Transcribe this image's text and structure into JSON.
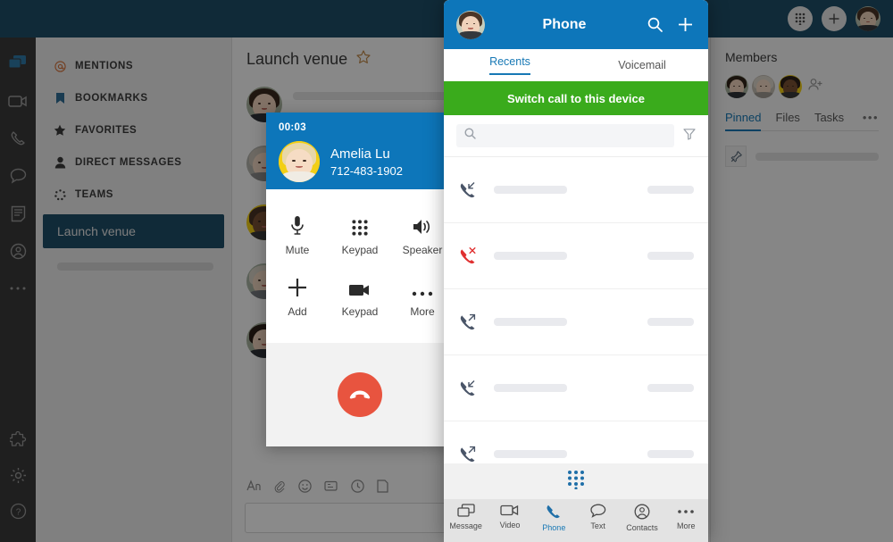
{
  "topbar": {
    "dialpad_icon": "dialpad-icon",
    "add_icon": "plus-icon",
    "avatar_icon": "user-avatar"
  },
  "rail": {
    "items": [
      {
        "icon": "message-icon",
        "name": "rail-message",
        "active": true
      },
      {
        "icon": "video-icon",
        "name": "rail-video",
        "active": false
      },
      {
        "icon": "phone-icon",
        "name": "rail-phone",
        "active": false
      },
      {
        "icon": "text-bubble-icon",
        "name": "rail-text",
        "active": false
      },
      {
        "icon": "tasks-icon",
        "name": "rail-tasks",
        "active": false
      },
      {
        "icon": "contacts-icon",
        "name": "rail-contacts",
        "active": false
      },
      {
        "icon": "more-icon",
        "name": "rail-more",
        "active": false
      }
    ],
    "bottom": [
      {
        "icon": "apps-puzzle-icon",
        "name": "rail-apps"
      },
      {
        "icon": "gear-icon",
        "name": "rail-settings"
      },
      {
        "icon": "help-icon",
        "name": "rail-help"
      }
    ]
  },
  "sidebar": {
    "items": [
      {
        "label": "MENTIONS",
        "icon": "at-icon"
      },
      {
        "label": "BOOKMARKS",
        "icon": "bookmark-icon"
      },
      {
        "label": "FAVORITES",
        "icon": "star-icon"
      },
      {
        "label": "DIRECT MESSAGES",
        "icon": "person-icon"
      },
      {
        "label": "TEAMS",
        "icon": "teams-icon"
      }
    ],
    "selected_team": "Launch venue"
  },
  "main": {
    "title": "Launch venue",
    "favorite_icon": "star-outline-icon",
    "message_count": 5,
    "compose_tools": [
      {
        "name": "format-text-icon"
      },
      {
        "name": "attach-icon"
      },
      {
        "name": "emoji-icon"
      },
      {
        "name": "gif-icon"
      },
      {
        "name": "schedule-icon"
      },
      {
        "name": "file-icon"
      }
    ]
  },
  "right_panel": {
    "title": "Members",
    "member_count": 3,
    "add_member_icon": "add-person-icon",
    "tabs": [
      {
        "label": "Pinned",
        "active": true
      },
      {
        "label": "Files",
        "active": false
      },
      {
        "label": "Tasks",
        "active": false
      }
    ],
    "overflow_label": "•••",
    "pin_icon": "pin-icon"
  },
  "call_dialog": {
    "timer": "00:03",
    "caller_name": "Amelia Lu",
    "caller_number": "712-483-1902",
    "buttons": [
      {
        "label": "Mute",
        "icon": "microphone-icon"
      },
      {
        "label": "Keypad",
        "icon": "dialpad-icon"
      },
      {
        "label": "Speaker",
        "icon": "speaker-icon"
      },
      {
        "label": "Add",
        "icon": "plus-icon"
      },
      {
        "label": "Keypad",
        "icon": "video-camera-icon"
      },
      {
        "label": "More",
        "icon": "more-dots-icon"
      }
    ],
    "hangup_icon": "hangup-icon",
    "hangup_color": "#e8543f",
    "header_color": "#0d76ba"
  },
  "phone_panel": {
    "title": "Phone",
    "search_icon": "search-icon",
    "add_icon": "plus-icon",
    "avatar_icon": "user-avatar",
    "tabs": [
      {
        "label": "Recents",
        "active": true
      },
      {
        "label": "Voicemail",
        "active": false
      }
    ],
    "switch_banner": "Switch call to this device",
    "switch_banner_color": "#3aab1c",
    "search": {
      "placeholder": "",
      "value": "",
      "icon": "search-icon",
      "filter_icon": "filter-funnel-icon"
    },
    "recents": [
      {
        "type": "incoming",
        "icon": "call-incoming-icon",
        "color": "#4a5568"
      },
      {
        "type": "missed",
        "icon": "call-missed-icon",
        "color": "#e03131"
      },
      {
        "type": "outgoing",
        "icon": "call-outgoing-icon",
        "color": "#4a5568"
      },
      {
        "type": "incoming",
        "icon": "call-incoming-icon",
        "color": "#4a5568"
      },
      {
        "type": "outgoing",
        "icon": "call-outgoing-icon",
        "color": "#4a5568"
      }
    ],
    "dialpad_icon": "dialpad-icon",
    "nav": [
      {
        "label": "Message",
        "icon": "message-icon",
        "active": false
      },
      {
        "label": "Video",
        "icon": "video-icon",
        "active": false
      },
      {
        "label": "Phone",
        "icon": "phone-icon",
        "active": true
      },
      {
        "label": "Text",
        "icon": "text-bubble-icon",
        "active": false
      },
      {
        "label": "Contacts",
        "icon": "contacts-icon",
        "active": false
      },
      {
        "label": "More",
        "icon": "more-icon",
        "active": false
      }
    ]
  },
  "colors": {
    "brand_blue": "#0d76ba",
    "topbar_blue": "#1f4e68",
    "green": "#3aab1c",
    "red": "#e8543f",
    "accent_link": "#1778b5"
  }
}
